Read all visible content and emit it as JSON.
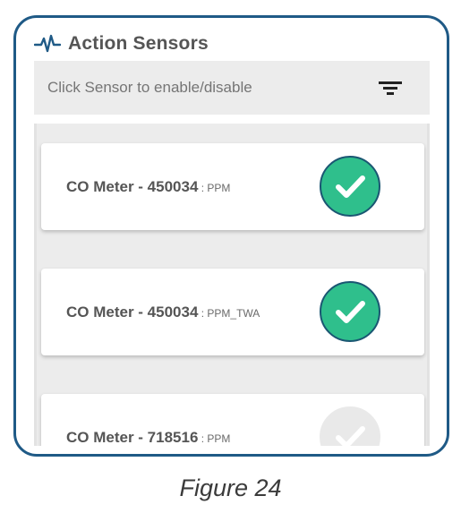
{
  "header": {
    "title": "Action Sensors",
    "icon": "activity-pulse-icon",
    "accent_color": "#1f5a86"
  },
  "filter_bar": {
    "hint": "Click Sensor to enable/disable",
    "icon": "filter-icon"
  },
  "sensors": [
    {
      "name": "CO Meter - 450034",
      "separator": " : ",
      "unit": "PPM",
      "enabled": true
    },
    {
      "name": "CO Meter - 450034",
      "separator": " : ",
      "unit": "PPM_TWA",
      "enabled": true
    },
    {
      "name": "CO Meter - 718516",
      "separator": " : ",
      "unit": "PPM",
      "enabled": false
    }
  ],
  "colors": {
    "enabled": "#2fbf8c",
    "enabled_border": "#1a5672",
    "disabled": "#e9e9e9"
  },
  "caption": "Figure 24"
}
